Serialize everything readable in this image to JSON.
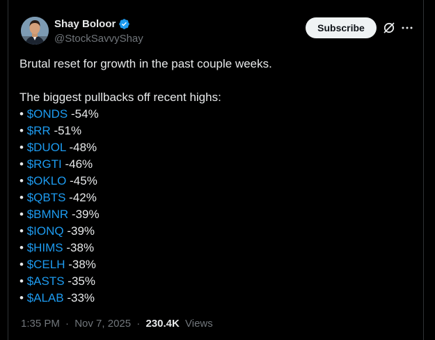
{
  "author": {
    "display_name": "Shay Boloor",
    "handle": "@StockSavvyShay",
    "verified": true
  },
  "actions": {
    "subscribe_label": "Subscribe",
    "grok_icon": "grok-slash-icon",
    "more_icon": "more-horizontal-icon"
  },
  "tweet": {
    "intro": "Brutal reset for growth in the past couple weeks.",
    "subtitle": "The biggest pullbacks off recent highs:",
    "bullet": "•",
    "items": [
      {
        "ticker": "$ONDS",
        "change": "-54%"
      },
      {
        "ticker": "$RR",
        "change": "-51%"
      },
      {
        "ticker": "$DUOL",
        "change": "-48%"
      },
      {
        "ticker": "$RGTI",
        "change": "-46%"
      },
      {
        "ticker": "$OKLO",
        "change": "-45%"
      },
      {
        "ticker": "$QBTS",
        "change": "-42%"
      },
      {
        "ticker": "$BMNR",
        "change": "-39%"
      },
      {
        "ticker": "$IONQ",
        "change": "-39%"
      },
      {
        "ticker": "$HIMS",
        "change": "-38%"
      },
      {
        "ticker": "$CELH",
        "change": "-38%"
      },
      {
        "ticker": "$ASTS",
        "change": "-35%"
      },
      {
        "ticker": "$ALAB",
        "change": "-33%"
      }
    ]
  },
  "meta": {
    "time": "1:35 PM",
    "separator": "·",
    "date": "Nov 7, 2025",
    "views_count": "230.4K",
    "views_label": "Views"
  },
  "colors": {
    "background": "#000000",
    "text": "#e7e9ea",
    "secondary": "#71767b",
    "link": "#1d9bf0",
    "verified": "#1d9bf0",
    "button_bg": "#eff3f4"
  }
}
